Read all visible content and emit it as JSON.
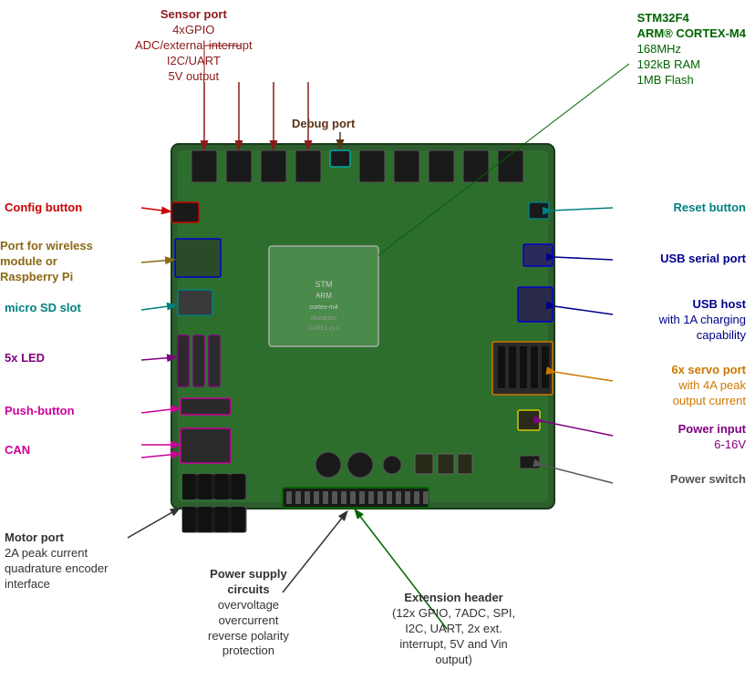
{
  "labels": {
    "sensor_port": {
      "title": "Sensor port",
      "lines": [
        "4xGPIO",
        "ADC/external interrupt",
        "I2C/UART",
        "5V output"
      ]
    },
    "debug_port": {
      "title": "Debug port"
    },
    "stm32": {
      "title": "STM32F4",
      "line1": "ARM® CORTEX-M4",
      "lines": [
        "168MHz",
        "192kB RAM",
        "1MB Flash"
      ]
    },
    "config_button": {
      "title": "Config button"
    },
    "wireless_port": {
      "title": "Port for wireless",
      "line2": "module or Raspberry Pi"
    },
    "microsd": {
      "title": "micro SD slot"
    },
    "led": {
      "title": "5x LED"
    },
    "pushbutton": {
      "title": "Push-button"
    },
    "can": {
      "title": "CAN"
    },
    "reset_button": {
      "title": "Reset button"
    },
    "usb_serial": {
      "title": "USB serial port"
    },
    "usb_host": {
      "title": "USB host",
      "lines": [
        "with 1A charging",
        "capability"
      ]
    },
    "servo_port": {
      "title": "6x servo port",
      "lines": [
        "with 4A peak",
        "output current"
      ]
    },
    "power_input": {
      "title": "Power input",
      "lines": [
        "6-16V"
      ]
    },
    "power_switch": {
      "title": "Power switch"
    },
    "motor_port": {
      "title": "Motor port",
      "lines": [
        "2A peak current",
        "quadrature encoder",
        "interface"
      ]
    },
    "power_supply": {
      "title": "Power supply",
      "line2": "circuits",
      "lines": [
        "overvoltage",
        "overcurrent",
        "reverse polarity",
        "protection"
      ]
    },
    "extension_header": {
      "title": "Extension header",
      "lines": [
        "(12x GPIO, 7ADC, SPI,",
        "I2C, UART, 2x ext.",
        "interrupt, 5V and Vin",
        "output)"
      ]
    }
  },
  "colors": {
    "sensor_port": "#8B1A1A",
    "debug_port": "#5C3317",
    "stm32": "#006400",
    "config": "#cc0000",
    "wireless": "#8B6914",
    "microsd": "#008080",
    "led": "#800080",
    "pushbutton": "#cc0099",
    "can": "#cc0099",
    "reset": "#008080",
    "usb_serial": "#00008B",
    "usb_host": "#00008B",
    "servo": "#cc7700",
    "power_input": "#800080",
    "power_switch": "#555555",
    "motor": "#333333",
    "power_supply": "#333333",
    "extension": "#006400"
  }
}
